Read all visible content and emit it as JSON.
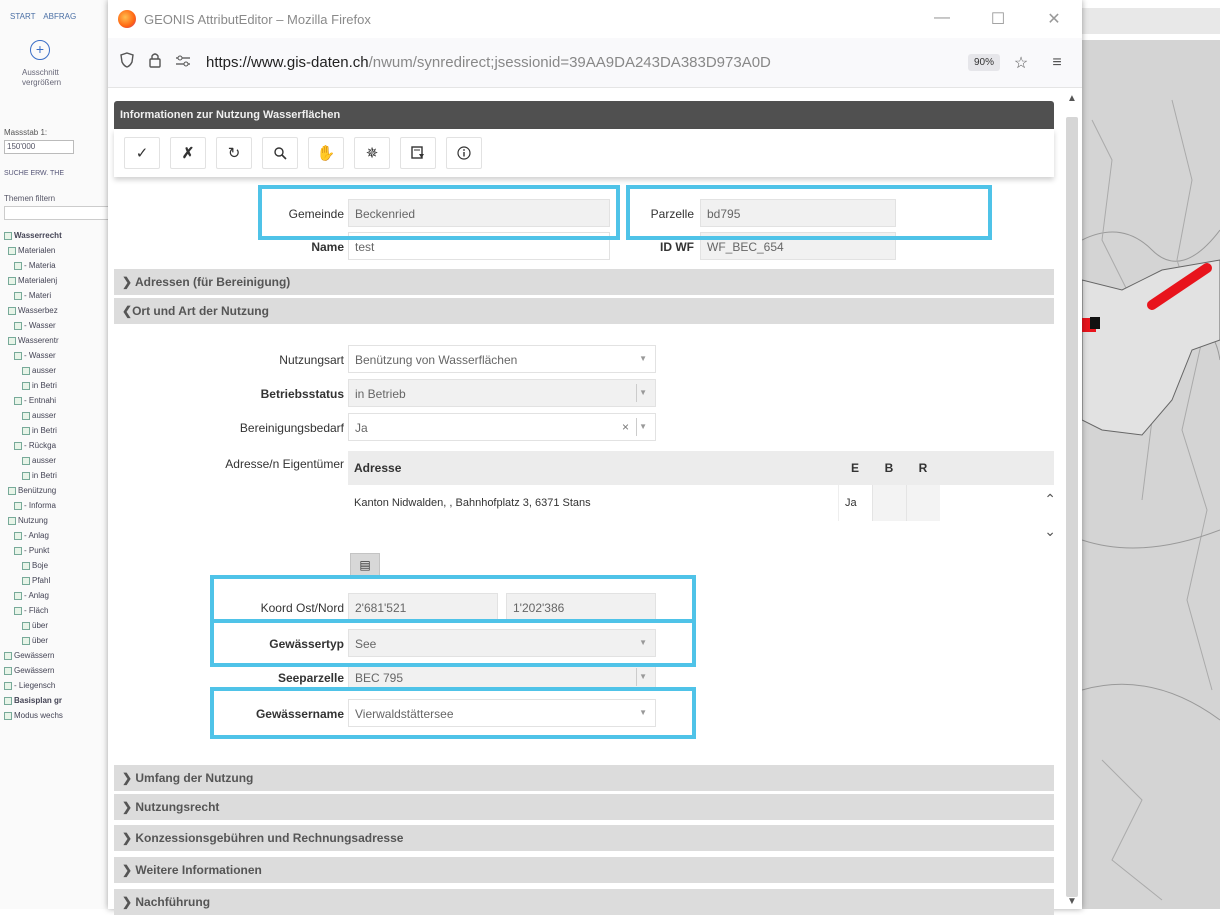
{
  "background": {
    "sidebar": {
      "tab_start": "START",
      "tab_abfrage": "ABFRAG",
      "zoom_label_1": "Ausschnitt",
      "zoom_label_2": "vergrößern",
      "scale_label": "Massstab 1:",
      "scale_value": "150'000",
      "search_tabs": "SUCHE ERW. THE",
      "themen_label": "Themen filtern",
      "tree": [
        "Wasserrecht",
        "Materialen",
        "- Materia",
        "Materialenj",
        "- Materi",
        "Wasserbez",
        "- Wasser",
        "Wasserentr",
        "- Wasser",
        "ausser",
        "in Betri",
        "- Entnahi",
        "ausser",
        "in Betri",
        "- Rückga",
        "ausser",
        "in Betri",
        "Benützung",
        "- Informa",
        "Nutzung",
        "- Anlag",
        "- Punkt",
        "Boje",
        "Pfahl",
        "- Anlag",
        "- Fläch",
        "über",
        "über",
        "Gewässern",
        "Gewässern",
        "- Liegensch",
        "Basisplan gr",
        "Modus wechs"
      ]
    }
  },
  "window": {
    "title": "GEONIS AttributEditor – Mozilla Firefox",
    "url_domain": "https://www.gis-daten.ch",
    "url_path": "/nwum/synredirect;jsessionid=39AA9DA243DA383D973A0D",
    "zoom": "90%"
  },
  "dialog": {
    "title": "Informationen zur Nutzung Wasserflächen",
    "toolbar_icons": [
      "check-icon",
      "cut-icon",
      "refresh-icon",
      "zoom-icon",
      "pan-icon",
      "highlight-icon",
      "filter-icon",
      "info-icon"
    ]
  },
  "form": {
    "gemeinde_label": "Gemeinde",
    "gemeinde_value": "Beckenried",
    "parzelle_label": "Parzelle",
    "parzelle_value": "bd795",
    "name_label": "Name",
    "name_value": "test",
    "idwf_label": "ID WF",
    "idwf_value": "WF_BEC_654",
    "section_adressen": "Adressen (für Bereinigung)",
    "section_ort": "Ort und Art der Nutzung",
    "nutzungsart_label": "Nutzungsart",
    "nutzungsart_value": "Benützung von Wasserflächen",
    "betriebsstatus_label": "Betriebsstatus",
    "betriebsstatus_value": "in Betrieb",
    "bereinigung_label": "Bereinigungsbedarf",
    "bereinigung_value": "Ja",
    "eigentuemer_label": "Adresse/n Eigentümer",
    "table_headers": [
      "Adresse",
      "E",
      "B",
      "R"
    ],
    "table_rows": [
      {
        "adresse": "Kanton Nidwalden, , Bahnhofplatz 3, 6371 Stans",
        "e": "Ja",
        "b": "",
        "r": ""
      }
    ],
    "koord_label": "Koord Ost/Nord",
    "koord_ost": "2'681'521",
    "koord_nord": "1'202'386",
    "gewaessertyp_label": "Gewässertyp",
    "gewaessertyp_value": "See",
    "seeparzelle_label": "Seeparzelle",
    "seeparzelle_value": "BEC 795",
    "gewaessername_label": "Gewässername",
    "gewaessername_value": "Vierwaldstättersee",
    "section_umfang": "Umfang der Nutzung",
    "section_nutzungsrecht": "Nutzungsrecht",
    "section_konzession": "Konzessionsgebühren und Rechnungsadresse",
    "section_weitere": "Weitere Informationen",
    "section_nachfuehrung": "Nachführung"
  },
  "colors": {
    "highlight": "#4fc3e8",
    "dialog_title_bg": "#505050",
    "section_bg": "#dcdcdc"
  }
}
